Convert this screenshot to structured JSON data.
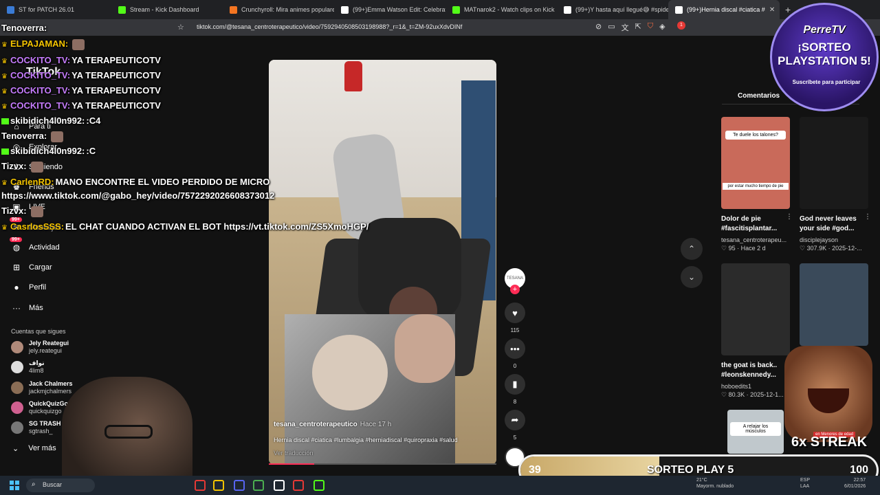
{
  "browser": {
    "tabs": [
      {
        "label": "ST for PATCH 26.01",
        "color": "#3a7bd5",
        "active": false
      },
      {
        "label": "Stream - Kick Dashboard",
        "color": "#53fc18",
        "active": false
      },
      {
        "label": "Crunchyroll: Mira animes populares",
        "color": "#f47521",
        "active": false
      },
      {
        "label": "(99+)Emma Watson Edit: Celebrate",
        "color": "#ffffff",
        "active": false
      },
      {
        "label": "MATnarok2 - Watch clips on Kick",
        "color": "#53fc18",
        "active": false
      },
      {
        "label": "(99+)Y hasta aquí llegué😅 #spiderm",
        "color": "#ffffff",
        "active": false
      },
      {
        "label": "(99+)Hernia discal #ciatica #",
        "color": "#ffffff",
        "active": true
      }
    ],
    "new_tab": "+",
    "close": "✕",
    "url": "tiktok.com/@tesana_centroterapeutico/video/7592940508503198988?_r=1&_t=ZM-92uxXdvDINf",
    "ext_badge": "1"
  },
  "sidebar": {
    "logo": "TikTok",
    "items": [
      {
        "label": "Para ti",
        "icon": "home-icon",
        "glyph": "⌂",
        "top": 0
      },
      {
        "label": "Explorar",
        "icon": "compass-icon",
        "glyph": "◎",
        "top": 0
      },
      {
        "label": "Siguiendo",
        "icon": "following-icon",
        "glyph": "♙",
        "top": 0
      },
      {
        "label": "Friends",
        "icon": "friends-icon",
        "glyph": "♚",
        "top": 0
      },
      {
        "label": "LIVE",
        "icon": "live-icon",
        "glyph": "▣",
        "top": 0
      },
      {
        "label": "Mensajes",
        "icon": "message-icon",
        "glyph": "✉",
        "badge": "99+"
      },
      {
        "label": "Actividad",
        "icon": "activity-icon",
        "glyph": "◍",
        "badge": "99+"
      },
      {
        "label": "Cargar",
        "icon": "upload-icon",
        "glyph": "⊞"
      },
      {
        "label": "Perfil",
        "icon": "profile-icon",
        "glyph": "●"
      },
      {
        "label": "Más",
        "icon": "more-icon",
        "glyph": "···"
      }
    ],
    "following_title": "Cuentas que sigues",
    "accounts": [
      {
        "name": "Jely Reategui",
        "handle": "jely.reategui",
        "color": "#b08a7a"
      },
      {
        "name": "نواف",
        "handle": "4lim8",
        "color": "#dddddd"
      },
      {
        "name": "Jack Chalmers",
        "handle": "jackmjchalmers",
        "color": "#8a6d55"
      },
      {
        "name": "QuickQuizGo",
        "handle": "quickquizgo",
        "color": "#d06090"
      },
      {
        "name": "SG TRASH",
        "handle": "sgtrash_",
        "color": "#777777"
      }
    ],
    "ver_mas": "Ver más"
  },
  "chat": [
    {
      "user": "Tenoverra:",
      "text": "",
      "color": "#ffffff",
      "badge": "",
      "emote": false
    },
    {
      "user": "ELPAJAMAN:",
      "text": "",
      "color": "#f4c400",
      "badge": "crown",
      "emote": true
    },
    {
      "user": "COCKITO_TV:",
      "text": "YA TERAPEUTICOTV",
      "color": "#c77dff",
      "badge": "crown",
      "emote": false
    },
    {
      "user": "COCKITO_TV:",
      "text": "YA TERAPEUTICOTV",
      "color": "#c77dff",
      "badge": "crown",
      "emote": false
    },
    {
      "user": "COCKITO_TV:",
      "text": "YA TERAPEUTICOTV",
      "color": "#c77dff",
      "badge": "crown",
      "emote": false
    },
    {
      "user": "COCKITO_TV:",
      "text": "YA TERAPEUTICOTV",
      "color": "#c77dff",
      "badge": "crown",
      "emote": false
    },
    {
      "user": "skibidich4l0n992:",
      "text": ":C4",
      "color": "#ffffff",
      "badge": "kick",
      "emote": false
    },
    {
      "user": "Tenoverra:",
      "text": "",
      "color": "#ffffff",
      "badge": "",
      "emote": true
    },
    {
      "user": "skibidich4l0n992:",
      "text": ":C",
      "color": "#ffffff",
      "badge": "kick",
      "emote": false
    },
    {
      "user": "Tizvx:",
      "text": "",
      "color": "#ffffff",
      "badge": "",
      "emote": true
    },
    {
      "user": "CarlenRD:",
      "text": "MANO ENCONTRE EL VIDEO PERDIDO DE MICRO",
      "color": "#f4c400",
      "badge": "crown",
      "emote": false
    },
    {
      "user": "",
      "text": "https://www.tiktok.com/@gabo_hey/video/7572292026608373012",
      "color": "#ffffff",
      "badge": "",
      "emote": false
    },
    {
      "user": "Tizvx:",
      "text": "",
      "color": "#ffffff",
      "badge": "",
      "emote": true
    },
    {
      "user": "CasrlosSSS:",
      "text": "EL CHAT CUANDO ACTIVAN EL BOT https://vt.tiktok.com/ZS5XmoHGP/",
      "color": "#f4c400",
      "badge": "crown",
      "emote": false
    }
  ],
  "video": {
    "author": "tesana_centroterapeutico",
    "age": "Hace 17 h",
    "description": "Hernia discal #ciatica #lumbalgia #herniadiscal #quiropraxia #salud",
    "translate": "Ver traducción",
    "progress": 0.2,
    "author_avatar": "TESANA"
  },
  "actions": [
    {
      "name": "like",
      "icon": "heart-icon",
      "glyph": "♥",
      "count": "115"
    },
    {
      "name": "comment",
      "icon": "comment-icon",
      "glyph": "•••",
      "count": "0"
    },
    {
      "name": "bookmark",
      "icon": "bookmark-icon",
      "glyph": "▮",
      "count": "8"
    },
    {
      "name": "share",
      "icon": "share-icon",
      "glyph": "➦",
      "count": "5"
    }
  ],
  "nav": {
    "up": "⌃",
    "down": "⌄"
  },
  "right": {
    "tab": "Comentarios",
    "videos": [
      {
        "title": "Dolor de pie #fascitisplantar...",
        "user": "tesana_centroterapeu...",
        "stats": "♡ 95 · Hace 2 d",
        "color": "#c96a5a",
        "caption1": "Te duele los talones?",
        "caption2": "por estar mucho tiempo de pie"
      },
      {
        "title": "God never leaves your side #god...",
        "user": "disciplejayson",
        "stats": "♡ 307.9K · 2025-12-...",
        "color": "#1a1a1a",
        "caption1": "",
        "caption2": ""
      },
      {
        "title": "the goat is back.. #leonskennedy...",
        "user": "hoboedits1",
        "stats": "♡ 80.3K · 2025-12-1...",
        "color": "#2b2b2b",
        "caption1": "",
        "caption2": ""
      },
      {
        "title": "",
        "user": "",
        "stats": "",
        "color": "#3a4a5a",
        "caption1": "",
        "caption2": ""
      },
      {
        "title": "",
        "user": "",
        "stats": "",
        "color": "#c0c8cc",
        "caption1": "A relajar los músculos",
        "caption2": ""
      }
    ]
  },
  "sorteo": {
    "brand": "PerreTV",
    "line1": "¡SORTEO",
    "line2": "PLAYSTATION 5!",
    "sub": "Suscríbete para participar"
  },
  "streak": {
    "label": "en Menores de edad",
    "value": "6x STREAK"
  },
  "goal": {
    "current": "39",
    "label": "SORTEO PLAY 5",
    "max": "100",
    "progress": 0.39
  },
  "taskbar": {
    "search": "Buscar",
    "weather": "21°C",
    "weather_desc": "Mayorm. nublado",
    "lang": "ESP",
    "lang2": "LAA",
    "time": "22:57",
    "date": "6/01/2026",
    "apps": [
      "#e53935",
      "#f4c400",
      "#5865f2",
      "#4caf50",
      "#ffffff",
      "#e53935",
      "#53fc18"
    ]
  },
  "colors": {
    "accent": "#fe2c55",
    "kick": "#53fc18"
  }
}
